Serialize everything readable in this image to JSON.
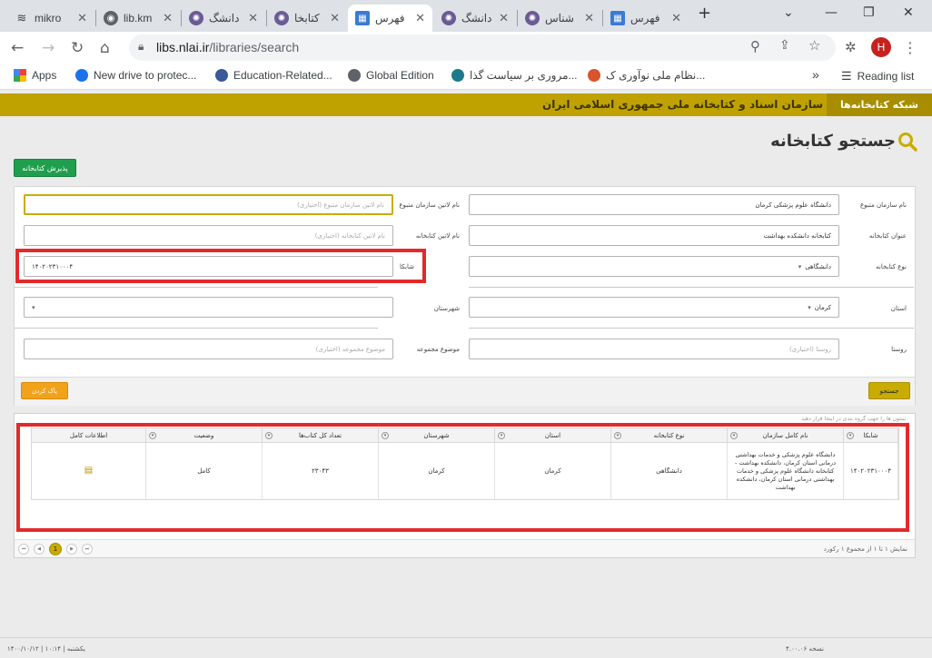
{
  "browser": {
    "tabs": [
      {
        "label": "mikro",
        "color": "#444"
      },
      {
        "label": "lib.km",
        "color": "#5f6368"
      },
      {
        "label": "دانشگ",
        "color": "#6b5b95"
      },
      {
        "label": "کتابخا",
        "color": "#6b5b95"
      },
      {
        "label": "فهرس",
        "color": "#3a7bd5",
        "active": true
      },
      {
        "label": "دانشگ",
        "color": "#6b5b95"
      },
      {
        "label": "شناس",
        "color": "#6b5b95"
      },
      {
        "label": "فهرس",
        "color": "#3a7bd5"
      }
    ],
    "new_tab": "+",
    "url_host": "libs.nlai.ir",
    "url_path": "/libraries/search",
    "avatar_letter": "H",
    "bookmarks": [
      {
        "label": "Apps"
      },
      {
        "label": "New drive to protec..."
      },
      {
        "label": "Education-Related..."
      },
      {
        "label": "Global Edition"
      },
      {
        "label": "مروری بر سیاست گذا..."
      },
      {
        "label": "نظام ملی نوآوری ک..."
      },
      {
        "label": "Reading list"
      }
    ],
    "more": "»"
  },
  "site": {
    "network_label": "شبکه کتابخانه‌ها",
    "org_name": "سازمان اسناد و کتابخانه ملی جمهوری اسلامی ایران",
    "page_title": "جستجو کتابخانه",
    "add_library_button": "پذیرش کتابخانه"
  },
  "form": {
    "org_name_label": "نام سازمان متبوع",
    "org_name_value": "دانشگاه علوم پزشکی کرمان",
    "org_latin_label": "نام لاتین سازمان متبوع",
    "org_latin_placeholder": "نام لاتین سازمان متبوع (اختیاری)",
    "lib_title_label": "عنوان کتابخانه",
    "lib_title_value": "کتابخانه دانشکده بهداشت",
    "lib_latin_label": "نام لاتین کتابخانه",
    "lib_latin_placeholder": "نام لاتین کتابخانه (اختیاری)",
    "lib_type_label": "نوع کتابخانه",
    "lib_type_value": "دانشگاهی",
    "shabka_label": "شابکا",
    "shabka_value": "۱۴۰۲۰۲۳۱۰۰۰۴",
    "province_label": "استان",
    "province_value": "کرمان",
    "city_label": "شهرستان",
    "city_value": "",
    "village_label": "روستا",
    "village_placeholder": "روستا (اختیاری)",
    "collection_label": "موضوع مجموعه",
    "collection_placeholder": "موضوع مجموعه (اختیاری)",
    "search_button": "جستجو",
    "clear_button": "پاک کردن"
  },
  "results": {
    "group_hint": "ستون ها را جهت گروه بندی در اینجا قرار دهید",
    "columns": [
      "شابکا",
      "نام کامل سازمان",
      "نوع کتابخانه",
      "استان",
      "شهرستان",
      "تعداد کل کتاب‌ها",
      "وضعیت",
      "اطلاعات کامل"
    ],
    "row": {
      "shabka": "۱۴۰۲۰۲۳۱۰۰۰۴",
      "full_name": "دانشگاه علوم پزشکی و خدمات بهداشتی درمانی استان کرمان، دانشکده بهداشت - کتابخانه دانشگاه علوم پزشکی و خدمات بهداشتی درمانی استان کرمان، دانشکده بهداشت",
      "lib_type": "دانشگاهی",
      "province": "کرمان",
      "city": "کرمان",
      "book_count": "۲۳۰۴۳",
      "status": "کامل"
    },
    "page_current": "1",
    "page_info": "نمایش ۱ تا ۱ از مجموع ۱ رکورد"
  },
  "footer": {
    "datetime": "۱۴۰۰/۱۰/۱۲ | یکشنبه | ۱۰:۱۴",
    "version": "نسخه ۴.۰۰.۰۶"
  }
}
